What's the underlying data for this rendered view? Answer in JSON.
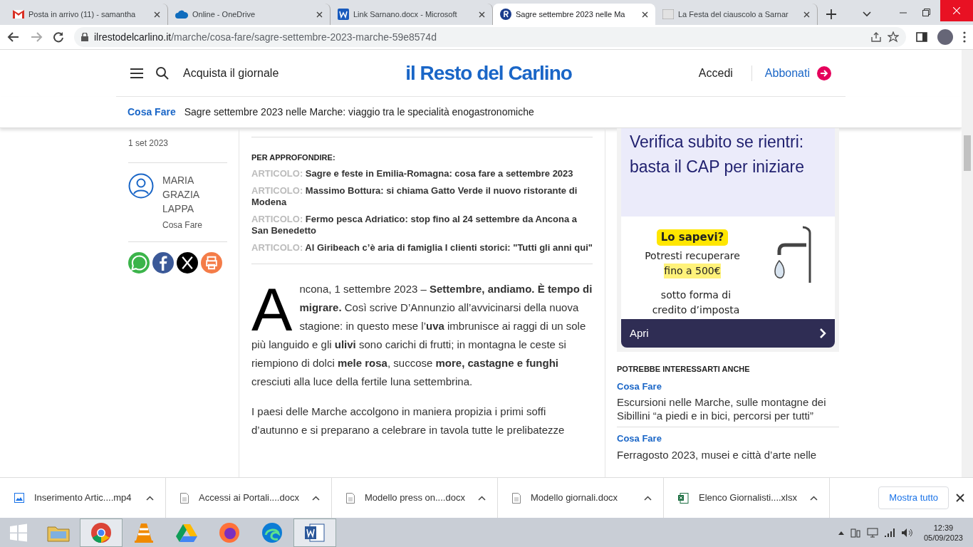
{
  "browser": {
    "tabs": [
      {
        "title": "Posta in arrivo (11) - samantha",
        "selected": false
      },
      {
        "title": "Online - OneDrive",
        "selected": false
      },
      {
        "title": "Link Sarnano.docx - Microsoft",
        "selected": false
      },
      {
        "title": "Sagre settembre 2023 nelle Ma",
        "selected": true
      },
      {
        "title": "La Festa del ciauscolo a Sarnar",
        "selected": false
      }
    ],
    "url_host": "ilrestodelcarlino.it",
    "url_path": "/marche/cosa-fare/sagre-settembre-2023-marche-59e8574d"
  },
  "header": {
    "buy": "Acquista il giornale",
    "logo": "il Resto del Carlino",
    "login": "Accedi",
    "subscribe": "Abbonati"
  },
  "breadcrumb": {
    "section": "Cosa Fare",
    "title": "Sagre settembre 2023 nelle Marche: viaggio tra le specialità enogastronomiche"
  },
  "article": {
    "date": "1 set 2023",
    "author": "MARIA GRAZIA LAPPA",
    "author_section": "Cosa Fare",
    "share": [
      {
        "kind": "whatsapp"
      },
      {
        "kind": "facebook"
      },
      {
        "kind": "x"
      },
      {
        "kind": "print"
      }
    ],
    "related_heading": "PER APPROFONDIRE:",
    "related": [
      {
        "label": "ARTICOLO:",
        "title": "Sagre e feste in Emilia-Romagna: cosa fare a settembre 2023"
      },
      {
        "label": "ARTICOLO:",
        "title": "Massimo Bottura: si chiama Gatto Verde il nuovo ristorante di Modena"
      },
      {
        "label": "ARTICOLO:",
        "title": "Fermo pesca Adriatico: stop fino al 24 settembre da Ancona a San Benedetto"
      },
      {
        "label": "ARTICOLO:",
        "title": "Al Giribeach c’è aria di famiglia I clienti storici: \"Tutti gli anni qui\""
      }
    ],
    "drop_cap": "A",
    "paragraphs": [
      "ncona, 1 settembre 2023 – **Settembre, andiamo. È tempo di migrare.** Così scrive D’Annunzio all’avvicinarsi della nuova stagione: in questo mese l’**uva** imbrunisce ai raggi di un sole più languido e gli **ulivi** sono carichi di frutti; in montagna le ceste si riempiono di dolci **mele rosa**, succose **more, castagne e funghi** cresciuti alla luce della fertile luna settembrina.",
      "I paesi delle Marche accolgono in maniera propizia i primi soffi d’autunno e si preparano a celebrare in tavola tutte le prelibatezze"
    ]
  },
  "ad": {
    "headline": "Verifica subito se rientri: basta il CAP per iniziare",
    "badge": "Lo sapevi?",
    "line_1": "Potresti recuperare",
    "highlight": "fino a 500€",
    "line_2": "sotto forma di",
    "line_3": "credito d’imposta",
    "button": "Apri"
  },
  "related_sidebar": {
    "heading": "POTREBBE INTERESSARTI ANCHE",
    "items": [
      {
        "section": "Cosa Fare",
        "title": "Escursioni nelle Marche, sulle montagne dei Sibillini “a piedi e in bici, percorsi per tutti”"
      },
      {
        "section": "Cosa Fare",
        "title": "Ferragosto 2023, musei e città d’arte nelle"
      }
    ]
  },
  "downloads": {
    "items": [
      {
        "name": "Inserimento Artic....mp4",
        "kind": "video"
      },
      {
        "name": "Accessi ai Portali....docx",
        "kind": "doc"
      },
      {
        "name": "Modello press on....docx",
        "kind": "doc"
      },
      {
        "name": "Modello giornali.docx",
        "kind": "doc"
      },
      {
        "name": "Elenco Giornalisti....xlsx",
        "kind": "sheet"
      }
    ],
    "show_all": "Mostra tutto"
  },
  "taskbar": {
    "apps": [
      {
        "kind": "folder",
        "active": false
      },
      {
        "kind": "chrome",
        "active": true
      },
      {
        "kind": "cone",
        "active": false
      },
      {
        "kind": "drive",
        "active": false
      },
      {
        "kind": "firefox",
        "active": false
      },
      {
        "kind": "edge",
        "active": false
      },
      {
        "kind": "word",
        "active": true
      }
    ],
    "time": "12:39",
    "date": "05/09/2023"
  }
}
